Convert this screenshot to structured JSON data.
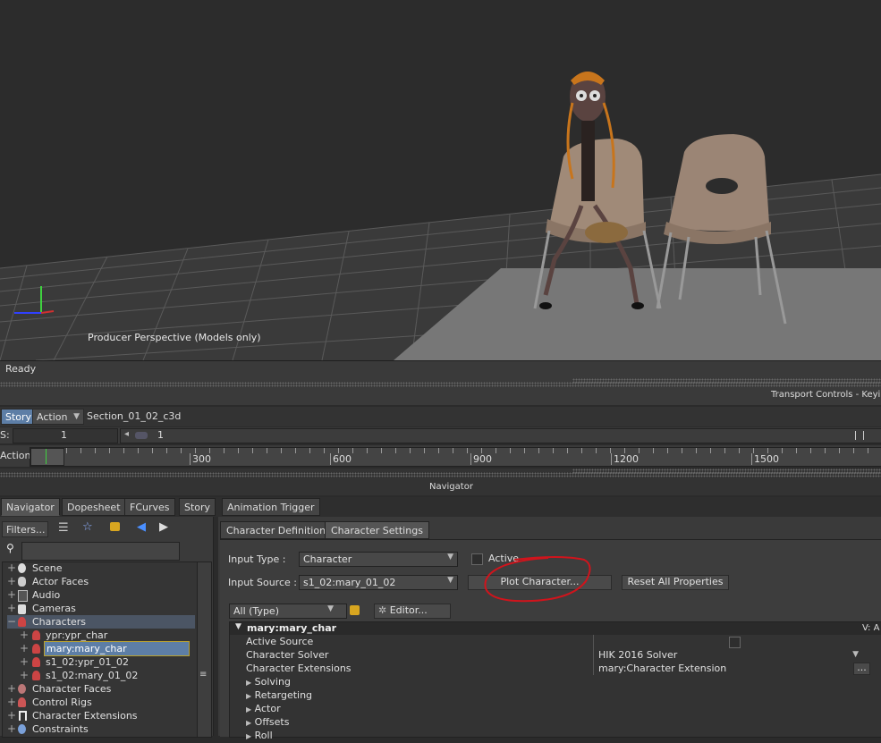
{
  "viewport": {
    "label": "Producer Perspective (Models only)"
  },
  "status": {
    "text": "Ready"
  },
  "transport": {
    "label": "Transport Controls  -  Keying G"
  },
  "story": {
    "story_tab": "Story",
    "action_dropdown": "Action",
    "section_name": "Section_01_02_c3d",
    "s_label": "S:",
    "s_value": "1",
    "s_value2": "1",
    "action_label": "Action",
    "ruler_ticks": [
      "300",
      "600",
      "900",
      "1200",
      "1500"
    ]
  },
  "navigator_bar": {
    "label": "Navigator"
  },
  "tabs": [
    "Navigator",
    "Dopesheet",
    "FCurves",
    "Story",
    "Animation Trigger"
  ],
  "left_panel": {
    "filters_button": "Filters...",
    "search_placeholder": "",
    "tree": [
      {
        "label": "Scene",
        "icon": "scene-icon"
      },
      {
        "label": "Actor Faces",
        "icon": "actor-faces-icon"
      },
      {
        "label": "Audio",
        "icon": "audio-icon"
      },
      {
        "label": "Cameras",
        "icon": "camera-icon"
      },
      {
        "label": "Characters",
        "icon": "characters-icon"
      },
      {
        "label": "ypr:ypr_char",
        "icon": "character-icon"
      },
      {
        "label": "mary:mary_char",
        "icon": "character-icon"
      },
      {
        "label": "s1_02:ypr_01_02",
        "icon": "character-icon"
      },
      {
        "label": "s1_02:mary_01_02",
        "icon": "character-icon"
      },
      {
        "label": "Character Faces",
        "icon": "character-faces-icon"
      },
      {
        "label": "Control Rigs",
        "icon": "control-rigs-icon"
      },
      {
        "label": "Character Extensions",
        "icon": "character-extensions-icon"
      },
      {
        "label": "Constraints",
        "icon": "constraints-icon"
      }
    ]
  },
  "right_panel": {
    "tabs": [
      "Character Definition",
      "Character Settings"
    ],
    "input_type_label": "Input Type :",
    "input_type_value": "Character",
    "active_label": "Active",
    "input_source_label": "Input Source :",
    "input_source_value": "s1_02:mary_01_02",
    "plot_button": "Plot Character...",
    "reset_button": "Reset All Properties",
    "filter_value": "All (Type)",
    "editor_button": "Editor...",
    "prop_header": "mary:mary_char",
    "prop_header_right": "V: A",
    "properties": [
      {
        "name": "Active Source",
        "value": ""
      },
      {
        "name": "Character Solver",
        "value": "HIK 2016 Solver"
      },
      {
        "name": "Character Extensions",
        "value": "mary:Character Extension"
      }
    ],
    "groups": [
      "Solving",
      "Retargeting",
      "Actor",
      "Offsets",
      "Roll"
    ]
  },
  "colors": {
    "accent": "#5d7ea6",
    "annotation": "#d0141c"
  }
}
